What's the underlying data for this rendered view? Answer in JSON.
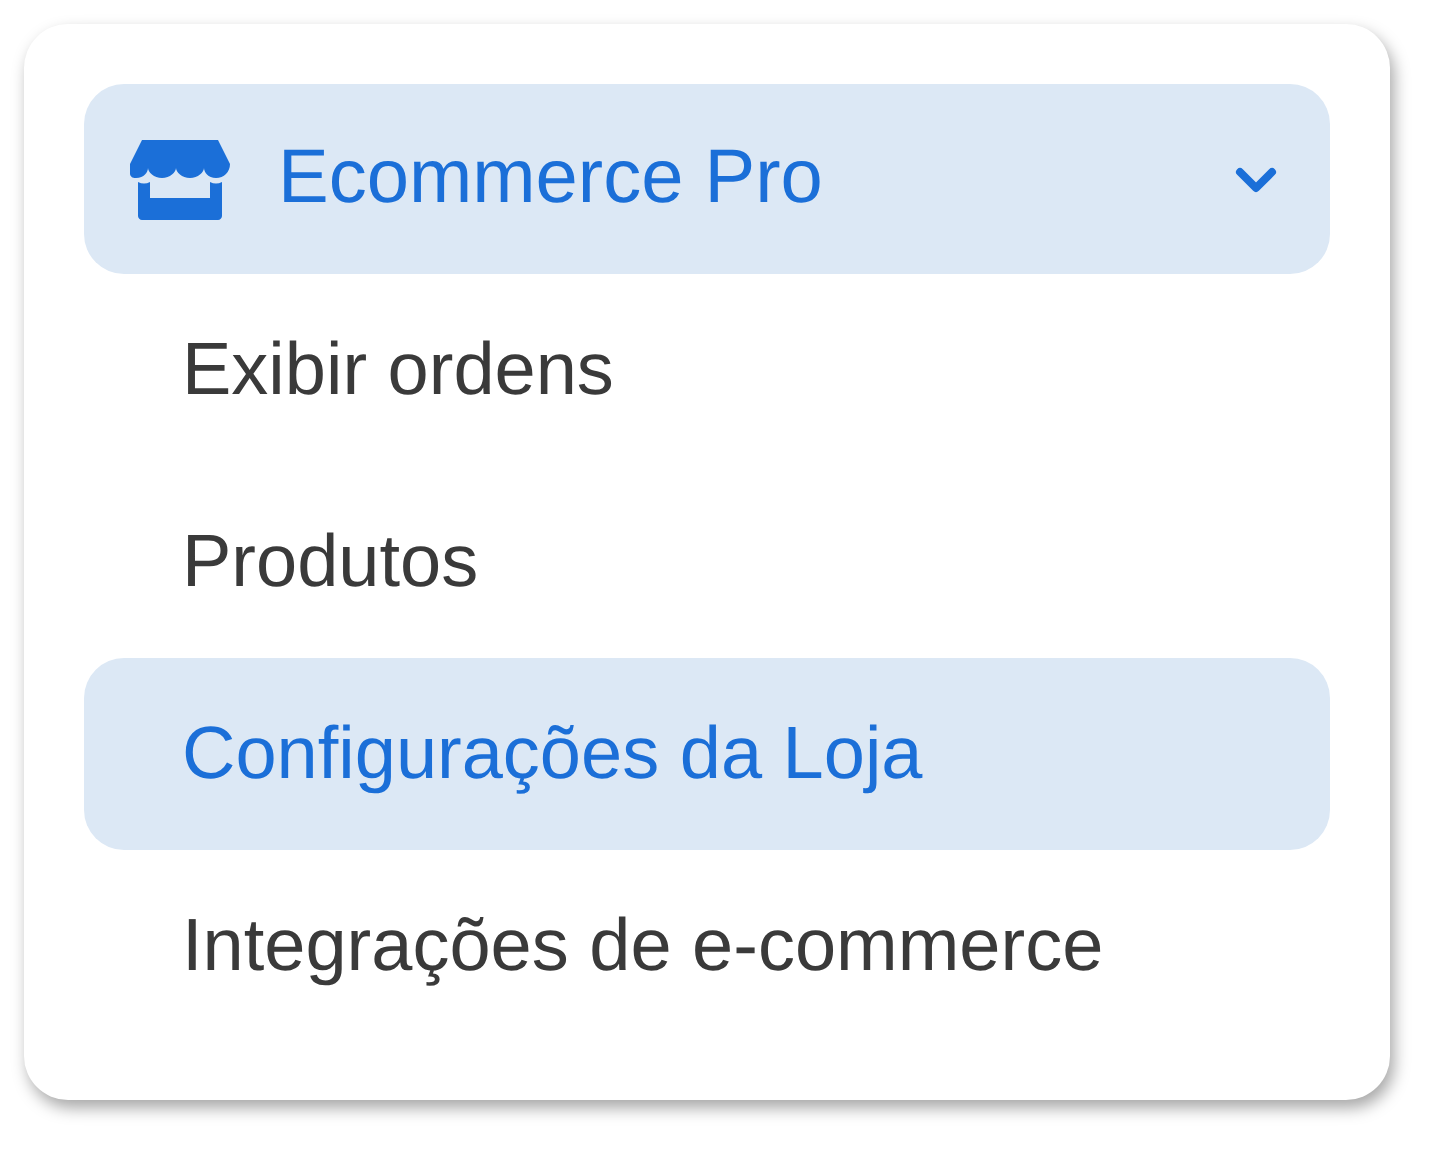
{
  "menu": {
    "header": {
      "label": "Ecommerce Pro",
      "expanded": true
    },
    "items": [
      {
        "label": "Exibir ordens",
        "selected": false
      },
      {
        "label": "Produtos",
        "selected": false
      },
      {
        "label": "Configurações da Loja",
        "selected": true
      },
      {
        "label": "Integrações de e-commerce",
        "selected": false
      }
    ]
  }
}
